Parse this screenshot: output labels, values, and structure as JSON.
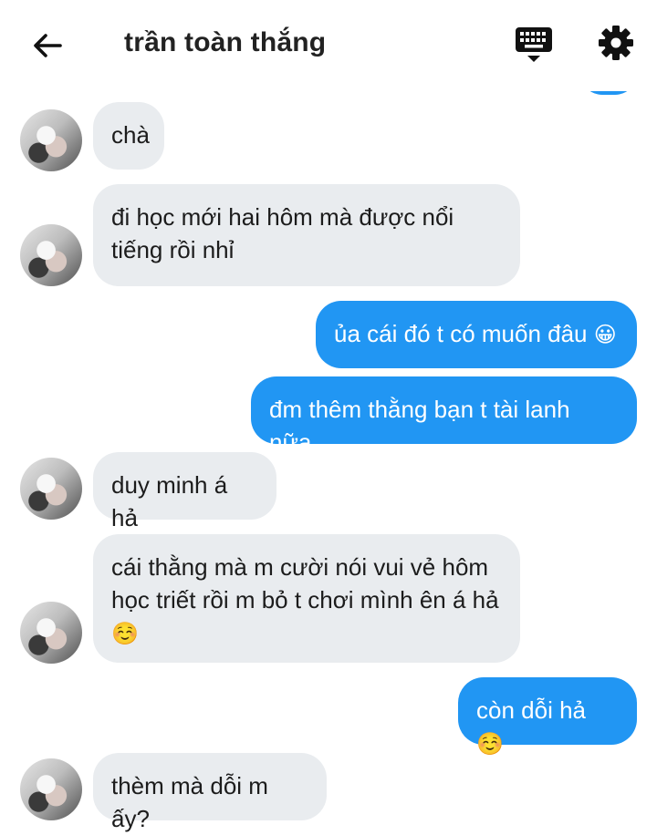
{
  "header": {
    "title": "trần toàn thắng",
    "back_icon": "arrow-left-icon",
    "keyboard_icon": "keyboard-icon",
    "settings_icon": "gear-icon"
  },
  "colors": {
    "outgoing_bubble": "#2196f3",
    "incoming_bubble": "#e9ecef",
    "outgoing_text": "#ffffff",
    "incoming_text": "#1c1c1c"
  },
  "messages": [
    {
      "direction": "incoming",
      "text": "chà"
    },
    {
      "direction": "incoming",
      "text": "đi học mới hai hôm mà được nổi tiếng rồi nhỉ"
    },
    {
      "direction": "outgoing",
      "text": "ủa cái đó t có muốn đâu",
      "emoji": "😀"
    },
    {
      "direction": "outgoing",
      "text": "đm thêm thằng bạn t tài lanh nữa"
    },
    {
      "direction": "incoming",
      "text": "duy minh á hả"
    },
    {
      "direction": "incoming",
      "text": "cái thằng mà m cười nói vui vẻ hôm học triết rồi m bỏ t chơi mình ên á hả",
      "emoji": "☺️"
    },
    {
      "direction": "outgoing",
      "text": "còn dỗi hả",
      "emoji": "☺️"
    },
    {
      "direction": "incoming",
      "text": "thèm mà dỗi m ấy?"
    }
  ]
}
